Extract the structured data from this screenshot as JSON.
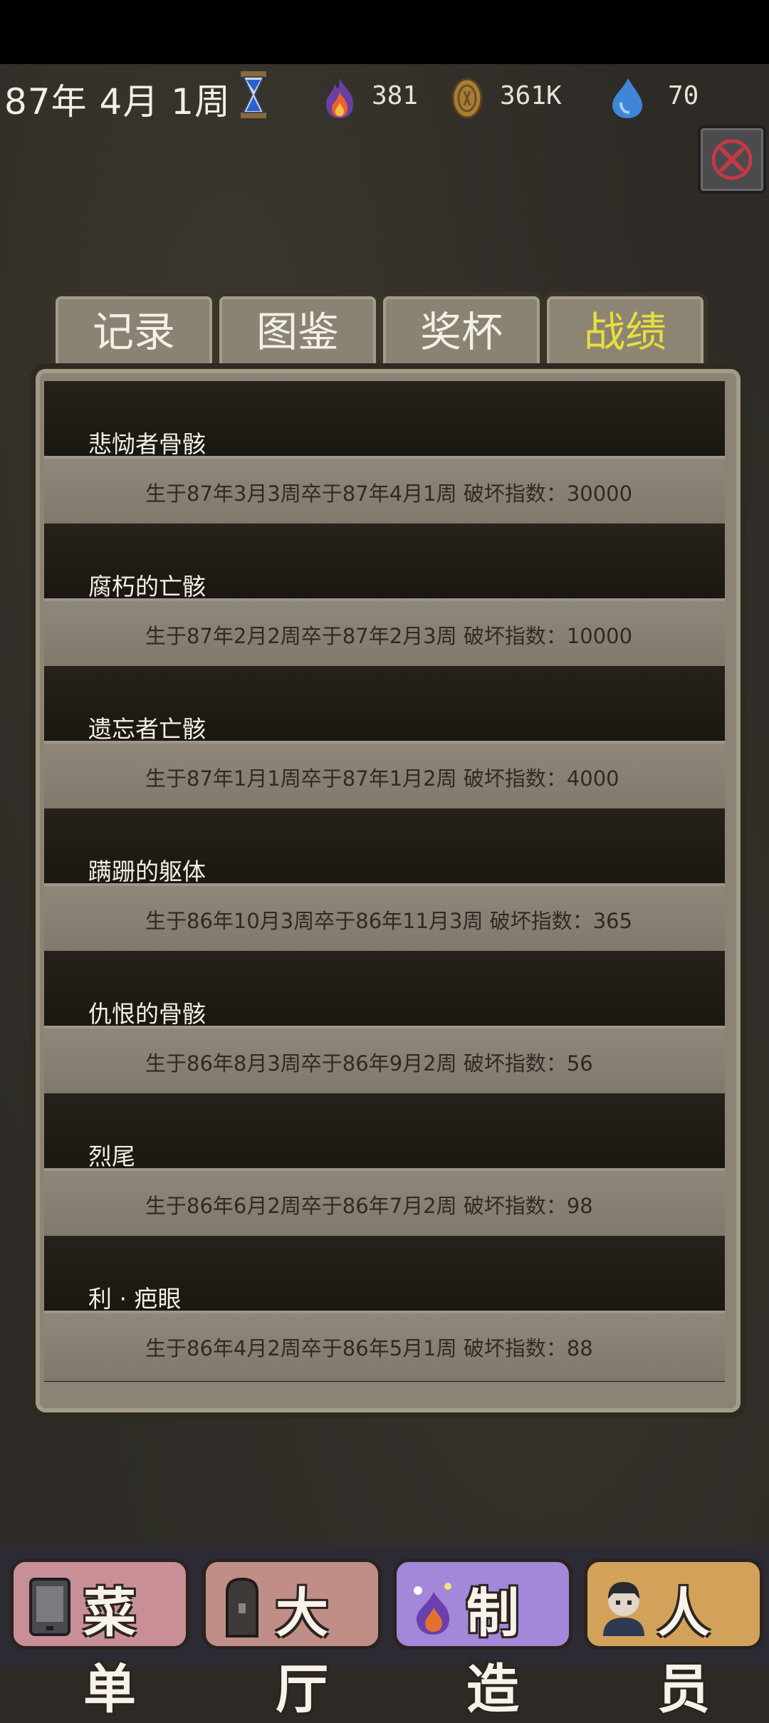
{
  "header": {
    "date": "87年 4月 1周",
    "flame_value": "381",
    "coin_value": "361K",
    "water_value": "70"
  },
  "tabs": [
    {
      "label": "记录"
    },
    {
      "label": "图鉴"
    },
    {
      "label": "奖杯"
    },
    {
      "label": "战绩",
      "active": true
    }
  ],
  "records": [
    {
      "name": "悲恸者骨骸",
      "info": "生于87年3月3周卒于87年4月1周   破坏指数：30000"
    },
    {
      "name": "腐朽的亡骸",
      "info": "生于87年2月2周卒于87年2月3周   破坏指数：10000"
    },
    {
      "name": "遗忘者亡骸",
      "info": "生于87年1月1周卒于87年1月2周   破坏指数：4000"
    },
    {
      "name": "蹒跚的躯体",
      "info": "生于86年10月3周卒于86年11月3周   破坏指数：365"
    },
    {
      "name": "仇恨的骨骸",
      "info": "生于86年8月3周卒于86年9月2周   破坏指数：56"
    },
    {
      "name": "烈尾",
      "info": "生于86年6月2周卒于86年7月2周   破坏指数：98"
    },
    {
      "name": "利 · 疤眼",
      "info": "生于86年4月2周卒于86年5月1周   破坏指数：88"
    }
  ],
  "nav": [
    {
      "label": "菜单"
    },
    {
      "label": "大厅"
    },
    {
      "label": "制造"
    },
    {
      "label": "人员"
    }
  ],
  "colors": {
    "active_tab_text": "#e8df3a",
    "nav_menu": "#c98f97",
    "nav_hall": "#c08e86",
    "nav_craft": "#a387d8",
    "nav_staff": "#d3a25a"
  }
}
